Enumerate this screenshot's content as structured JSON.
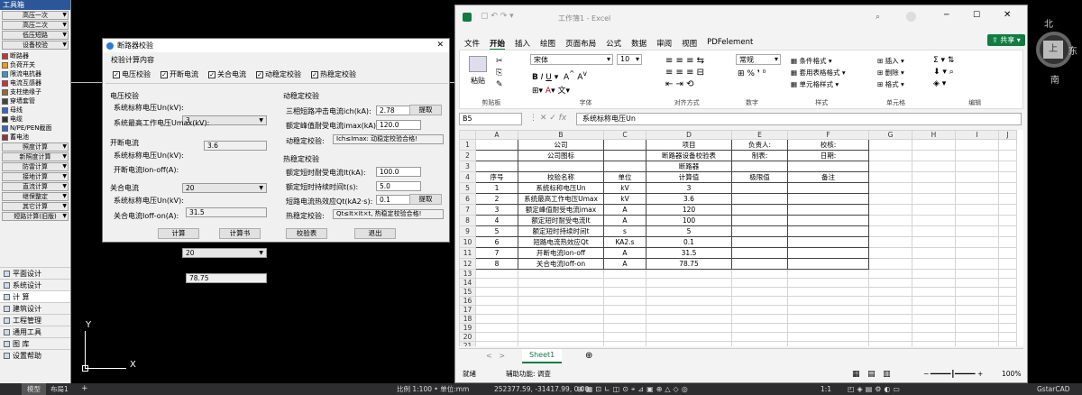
{
  "toolbox": {
    "title": "工具箱",
    "top_buttons": [
      "高压一次",
      "高压二次",
      "低压短路",
      "设备校验"
    ],
    "items": [
      "断路器",
      "负荷开关",
      "限流电抗器",
      "电流互感器",
      "支柱绝缘子",
      "穿墙套管",
      "母线",
      "电缆",
      "N/PE/PEN截面",
      "蓄电池"
    ],
    "bottom_buttons": [
      "照度计算",
      "新照度计算",
      "防雷计算",
      "接地计算",
      "直流计算",
      "继保整定",
      "其它计算",
      "短路计算(旧版)"
    ],
    "nav": [
      "平面设计",
      "系统设计",
      "计  算",
      "建筑设计",
      "工程管理",
      "通用工具",
      "图    库",
      "设置帮助"
    ]
  },
  "dialog": {
    "title": "断路器校验",
    "close": "✕",
    "content_header": "校验计算内容",
    "checks": [
      "电压校验",
      "开断电流",
      "关合电流",
      "动稳定校验",
      "热稳定校验"
    ],
    "check_mark": "✓",
    "voltage": {
      "header": "电压校验",
      "un_label": "系统标称电压Un(kV):",
      "un_value": "3",
      "umax_label": "系统最高工作电压Umax(kV):",
      "umax_value": "3.6"
    },
    "break": {
      "header": "开断电流",
      "un_label": "系统标称电压Un(kV):",
      "un_value": "20",
      "ioff_label": "开断电流Ion-off(A):",
      "ioff_value": "31.5"
    },
    "close_current": {
      "header": "关合电流",
      "un_label": "系统标称电压Un(kV):",
      "un_value": "20",
      "ion_label": "关合电流Ioff-on(A):",
      "ion_value": "78.75"
    },
    "dynamic": {
      "header": "动稳定校验",
      "ich_label": "三相短路冲击电流ich(kA):",
      "ich_value": "2.78",
      "fetch": "提取",
      "imax_label": "额定峰值耐受电流imax(kA):",
      "imax_value": "120.0",
      "check_label": "动稳定校验:",
      "check_result": "Ich≤Imax: 动稳定校验合格!"
    },
    "thermal": {
      "header": "热稳定校验",
      "it_label": "额定短时耐受电流It(kA):",
      "it_value": "100.0",
      "t_label": "额定短时持续时间t(s):",
      "t_value": "5.0",
      "qt_label": "短路电流热效应Qt(kA2·s):",
      "qt_value": "0.1",
      "fetch": "提取",
      "check_label": "热稳定校验:",
      "check_result": "Qt≤It×It×t, 热稳定校验合格!"
    },
    "buttons": [
      "计算",
      "计算书",
      "校验表",
      "退出"
    ]
  },
  "excel": {
    "title": "工作簿1 - Excel",
    "tabs": [
      "文件",
      "开始",
      "插入",
      "绘图",
      "页面布局",
      "公式",
      "数据",
      "审阅",
      "视图",
      "PDFelement"
    ],
    "active_tab": "开始",
    "share": "共享",
    "font_name": "宋体",
    "font_size": "10",
    "number_format": "常规",
    "groups": [
      "剪贴板",
      "字体",
      "对齐方式",
      "数字",
      "样式",
      "单元格",
      "编辑"
    ],
    "paste": "粘贴",
    "style_items": [
      "条件格式",
      "套用表格格式",
      "单元格样式"
    ],
    "cell_items": [
      "插入",
      "删除",
      "格式"
    ],
    "name_box": "B5",
    "formula": "系统标称电压Un",
    "col_headers": [
      "A",
      "B",
      "C",
      "D",
      "E",
      "F",
      "G",
      "H",
      "I",
      "J"
    ],
    "rows": [
      {
        "n": "1",
        "cells": [
          "",
          "公司",
          "",
          "项目",
          "负责人:",
          "校核:"
        ]
      },
      {
        "n": "2",
        "cells": [
          "",
          "公司图标",
          "",
          "断路器设备校验表",
          "制表:",
          "日期:"
        ]
      },
      {
        "n": "3",
        "cells": [
          "",
          "",
          "",
          "断路器",
          "",
          ""
        ]
      },
      {
        "n": "4",
        "cells": [
          "序号",
          "校验名称",
          "单位",
          "计算值",
          "极限值",
          "备注"
        ]
      },
      {
        "n": "5",
        "cells": [
          "1",
          "系统标称电压Un",
          "kV",
          "3",
          "",
          ""
        ]
      },
      {
        "n": "6",
        "cells": [
          "2",
          "系统最高工作电压Umax",
          "kV",
          "3.6",
          "",
          ""
        ]
      },
      {
        "n": "7",
        "cells": [
          "3",
          "额定峰值耐受电流imax",
          "A",
          "120",
          "",
          ""
        ]
      },
      {
        "n": "8",
        "cells": [
          "4",
          "额定短时耐受电流It",
          "A",
          "100",
          "",
          ""
        ]
      },
      {
        "n": "9",
        "cells": [
          "5",
          "额定短时持续时间t",
          "s",
          "5",
          "",
          ""
        ]
      },
      {
        "n": "10",
        "cells": [
          "6",
          "短路电流热效应Qt",
          "KA2.s",
          "0.1",
          "",
          ""
        ]
      },
      {
        "n": "11",
        "cells": [
          "7",
          "开断电流Ion-off",
          "A",
          "31.5",
          "",
          ""
        ]
      },
      {
        "n": "12",
        "cells": [
          "8",
          "关合电流Ioff-on",
          "A",
          "78.75",
          "",
          ""
        ]
      },
      {
        "n": "13",
        "cells": [
          "",
          "",
          "",
          "",
          "",
          ""
        ]
      },
      {
        "n": "14",
        "cells": [
          "",
          "",
          "",
          "",
          "",
          ""
        ]
      },
      {
        "n": "15",
        "cells": [
          "",
          "",
          "",
          "",
          "",
          ""
        ]
      },
      {
        "n": "16",
        "cells": [
          "",
          "",
          "",
          "",
          "",
          ""
        ]
      },
      {
        "n": "17",
        "cells": [
          "",
          "",
          "",
          "",
          "",
          ""
        ]
      },
      {
        "n": "18",
        "cells": [
          "",
          "",
          "",
          "",
          "",
          ""
        ]
      },
      {
        "n": "19",
        "cells": [
          "",
          "",
          "",
          "",
          "",
          ""
        ]
      },
      {
        "n": "20",
        "cells": [
          "",
          "",
          "",
          "",
          "",
          ""
        ]
      },
      {
        "n": "21",
        "cells": [
          "",
          "",
          "",
          "",
          "",
          ""
        ]
      },
      {
        "n": "22",
        "cells": [
          "",
          "",
          "",
          "",
          "",
          ""
        ]
      }
    ],
    "sheet": "Sheet1",
    "status_ready": "就绪",
    "status_access": "辅助功能: 调查",
    "zoom": "100%"
  },
  "compass": {
    "n": "北",
    "e": "东",
    "s": "南",
    "center": "上"
  },
  "statusbar": {
    "model": "模型",
    "layout": "布局1",
    "scale": "比例 1:100 • 单位:mm",
    "coords": "252377.59, -31417.99, 0.00",
    "ratio": "1:1",
    "app": "GstarCAD"
  },
  "ucs": {
    "x": "X",
    "y": "Y"
  }
}
